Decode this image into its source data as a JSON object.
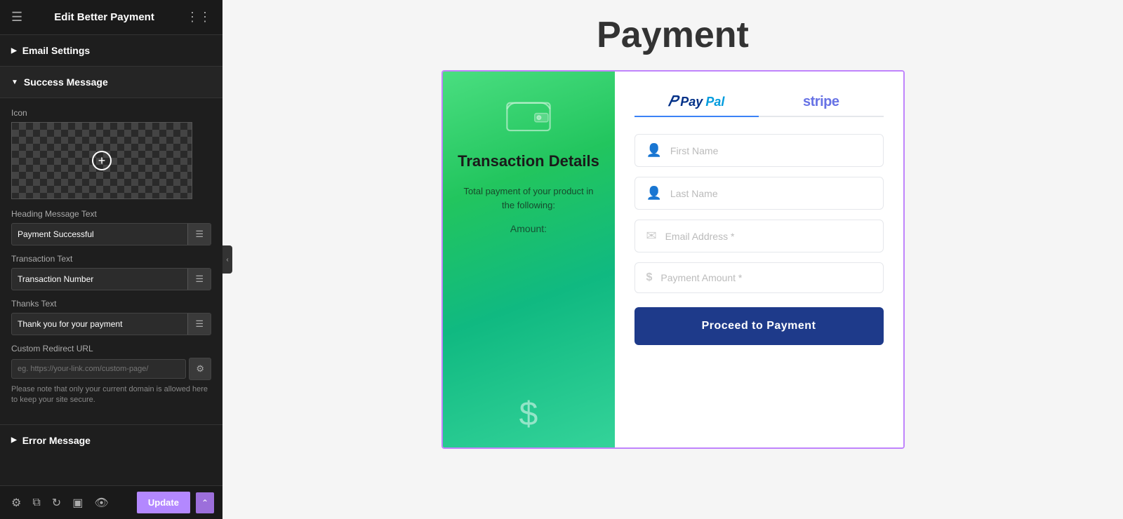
{
  "sidebar": {
    "header": {
      "title": "Edit Better Payment",
      "hamburger_icon": "≡",
      "grid_icon": "⊞"
    },
    "email_settings": {
      "label": "Email Settings",
      "collapsed": true
    },
    "success_message": {
      "label": "Success Message",
      "expanded": true,
      "icon_label": "Icon",
      "heading_message_text_label": "Heading Message Text",
      "heading_message_text_value": "Payment Successful",
      "transaction_text_label": "Transaction Text",
      "transaction_text_value": "Transaction Number",
      "thanks_text_label": "Thanks Text",
      "thanks_text_value": "Thank you for your payment",
      "custom_redirect_url_label": "Custom Redirect URL",
      "custom_redirect_url_placeholder": "eg. https://your-link.com/custom-page/",
      "note_text": "Please note that only your current domain is allowed here to keep your site secure."
    },
    "error_message": {
      "label": "Error Message",
      "collapsed": true
    },
    "bottom_toolbar": {
      "update_label": "Update"
    }
  },
  "main": {
    "page_title": "Payment",
    "widget": {
      "left": {
        "transaction_title": "Transaction Details",
        "transaction_desc": "Total payment of your product in the following:",
        "amount_label": "Amount:",
        "dollar_symbol": "$"
      },
      "tabs": [
        {
          "id": "paypal",
          "label": "PayPal",
          "active": true
        },
        {
          "id": "stripe",
          "label": "stripe",
          "active": false
        }
      ],
      "form": {
        "first_name_placeholder": "First Name",
        "last_name_placeholder": "Last Name",
        "email_placeholder": "Email Address *",
        "payment_amount_placeholder": "Payment Amount *",
        "submit_label": "Proceed to Payment"
      }
    }
  }
}
